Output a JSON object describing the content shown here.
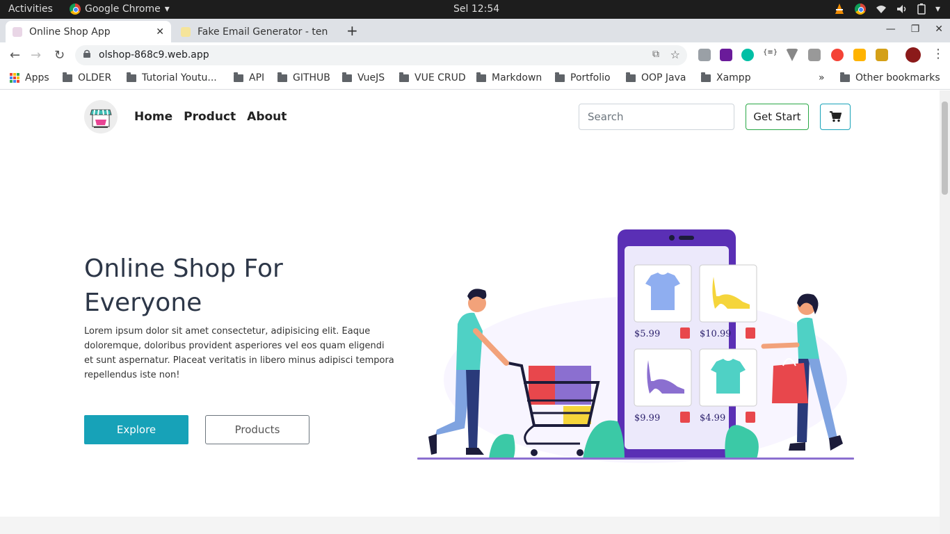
{
  "os": {
    "activities": "Activities",
    "app_name": "Google Chrome",
    "clock": "Sel 12:54"
  },
  "browser": {
    "tabs": [
      {
        "title": "Online Shop App",
        "active": true
      },
      {
        "title": "Fake Email Generator - ten",
        "active": false
      }
    ],
    "url": "olshop-868c9.web.app",
    "bookmarks": [
      "Apps",
      "OLDER",
      "Tutorial Youtu...",
      "API",
      "GITHUB",
      "VueJS",
      "VUE CRUD",
      "Markdown",
      "Portfolio",
      "OOP Java",
      "Xampp"
    ],
    "more_bookmarks": "»",
    "other_bookmarks": "Other bookmarks"
  },
  "site": {
    "nav": [
      "Home",
      "Product",
      "About"
    ],
    "search_placeholder": "Search",
    "get_start": "Get Start",
    "hero": {
      "title_line1": "Online Shop For",
      "title_line2": "Everyone",
      "text": "Lorem ipsum dolor sit amet consectetur, adipisicing elit. Eaque doloremque, doloribus provident asperiores vel eos quam eligendi et sunt aspernatur. Placeat veritatis in libero minus adipisci tempora repellendus iste non!",
      "explore": "Explore",
      "products": "Products"
    },
    "illustration_prices": [
      "$5.99",
      "$10.99",
      "$9.99",
      "$4.99"
    ]
  },
  "colors": {
    "primary_teal": "#17a2b8",
    "success_green": "#28a745",
    "phone_purple": "#5a2fb5"
  }
}
